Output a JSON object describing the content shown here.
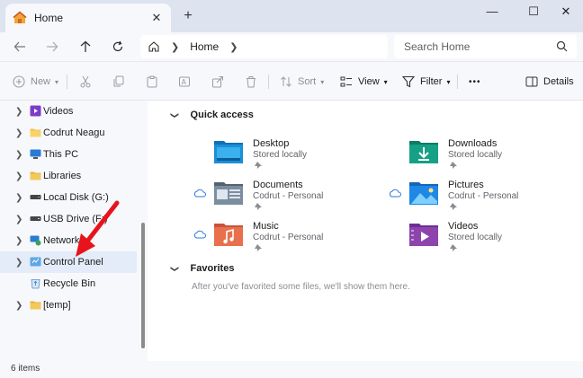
{
  "window": {
    "tab_title": "Home",
    "tab_close": "✕",
    "new_tab": "+",
    "minimize": "—",
    "maximize": "☐",
    "close": "✕"
  },
  "nav": {
    "breadcrumb": [
      "Home"
    ],
    "search_placeholder": "Search Home"
  },
  "toolbar": {
    "new_label": "New",
    "sort_label": "Sort",
    "view_label": "View",
    "filter_label": "Filter",
    "more_label": "•••",
    "details_label": "Details"
  },
  "sidebar": {
    "items": [
      {
        "label": "Videos",
        "icon": "videos-folder-icon",
        "chevron": true
      },
      {
        "label": "Codrut Neagu",
        "icon": "user-folder-icon",
        "chevron": true
      },
      {
        "label": "This PC",
        "icon": "pc-icon",
        "chevron": true
      },
      {
        "label": "Libraries",
        "icon": "libraries-icon",
        "chevron": true
      },
      {
        "label": "Local Disk (G:)",
        "icon": "drive-icon",
        "chevron": true
      },
      {
        "label": "USB Drive (F:)",
        "icon": "usb-drive-icon",
        "chevron": true
      },
      {
        "label": "Network",
        "icon": "network-icon",
        "chevron": true
      },
      {
        "label": "Control Panel",
        "icon": "control-panel-icon",
        "chevron": true,
        "selected": true
      },
      {
        "label": "Recycle Bin",
        "icon": "recycle-bin-icon",
        "chevron": false
      },
      {
        "label": "[temp]",
        "icon": "folder-icon",
        "chevron": true
      }
    ]
  },
  "main": {
    "quick_access_title": "Quick access",
    "quick_access": [
      {
        "name": "Desktop",
        "sub": "Stored locally",
        "color": "#1a8fd6",
        "cloud": false
      },
      {
        "name": "Downloads",
        "sub": "Stored locally",
        "color": "#16a085",
        "cloud": false
      },
      {
        "name": "Documents",
        "sub": "Codrut - Personal",
        "color": "#6f8091",
        "cloud": true
      },
      {
        "name": "Pictures",
        "sub": "Codrut - Personal",
        "color": "#1e88e5",
        "cloud": true
      },
      {
        "name": "Music",
        "sub": "Codrut - Personal",
        "color": "#e8704c",
        "cloud": true
      },
      {
        "name": "Videos",
        "sub": "Stored locally",
        "color": "#8e44ad",
        "cloud": false
      }
    ],
    "favorites_title": "Favorites",
    "favorites_note": "After you've favorited some files, we'll show them here."
  },
  "status": {
    "items_count": "6 items"
  },
  "colors": {
    "accent": "#0067c0",
    "annotation_arrow": "#e8141b"
  }
}
